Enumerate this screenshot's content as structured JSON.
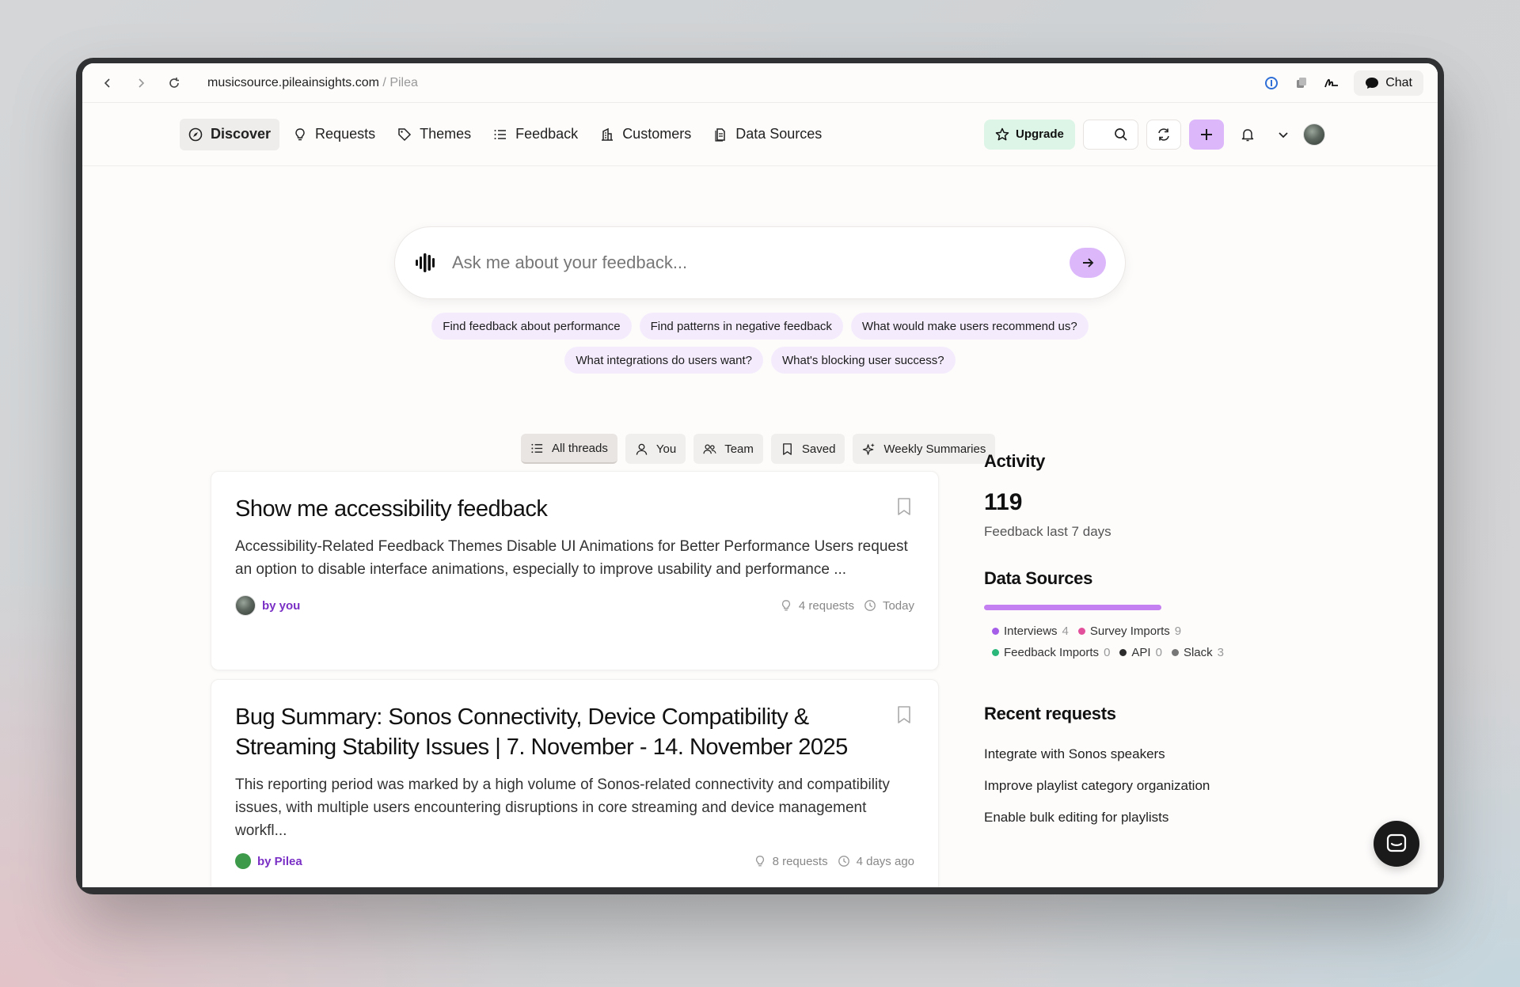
{
  "browser": {
    "url_domain": "musicsource.pileainsights.com",
    "url_separator": " / ",
    "url_title": "Pilea",
    "chat_label": "Chat"
  },
  "nav": {
    "tabs": [
      {
        "label": "Discover",
        "icon": "compass-icon",
        "active": true
      },
      {
        "label": "Requests",
        "icon": "lightbulb-icon"
      },
      {
        "label": "Themes",
        "icon": "tag-icon"
      },
      {
        "label": "Feedback",
        "icon": "list-icon"
      },
      {
        "label": "Customers",
        "icon": "building-icon"
      },
      {
        "label": "Data Sources",
        "icon": "database-icon"
      }
    ],
    "upgrade_label": "Upgrade"
  },
  "ask": {
    "placeholder": "Ask me about your feedback...",
    "suggestions_row1": [
      "Find feedback about performance",
      "Find patterns in negative feedback",
      "What would make users recommend us?"
    ],
    "suggestions_row2": [
      "What integrations do users want?",
      "What's blocking user success?"
    ]
  },
  "filters": [
    "All threads",
    "You",
    "Team",
    "Saved",
    "Weekly Summaries"
  ],
  "threads": [
    {
      "title": "Show me accessibility feedback",
      "body": "Accessibility-Related Feedback Themes Disable UI Animations for Better Performance Users request an option to disable interface animations, especially to improve usability and performance ...",
      "author": "by you",
      "requests": "4 requests",
      "time": "Today"
    },
    {
      "title": "Bug Summary: Sonos Connectivity, Device Compatibility & Streaming Stability Issues | 7. November - 14. November 2025",
      "body": "This reporting period was marked by a high volume of Sonos-related connectivity and compatibility issues, with multiple users encountering disruptions in core streaming and device management workfl...",
      "author": "by Pilea",
      "requests": "8 requests",
      "time": "4 days ago"
    }
  ],
  "activity": {
    "heading": "Activity",
    "count": "119",
    "subtitle": "Feedback last 7 days"
  },
  "data_sources": {
    "heading": "Data Sources",
    "items": [
      {
        "name": "Interviews",
        "count": "4",
        "color": "#a55ee8"
      },
      {
        "name": "Survey Imports",
        "count": "9",
        "color": "#e24f9b"
      },
      {
        "name": "Feedback Imports",
        "count": "0",
        "color": "#2bb77a"
      },
      {
        "name": "API",
        "count": "0",
        "color": "#2c2c2c"
      },
      {
        "name": "Slack",
        "count": "3",
        "color": "#777777"
      }
    ]
  },
  "recent_requests": {
    "heading": "Recent requests",
    "items": [
      "Integrate with Sonos speakers",
      "Improve playlist category organization",
      "Enable bulk editing for playlists"
    ]
  }
}
